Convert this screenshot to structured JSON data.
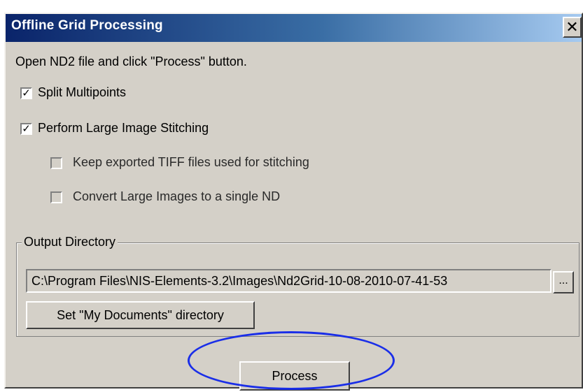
{
  "window": {
    "title": "Offline Grid Processing",
    "close_label": "✕"
  },
  "instructions": "Open ND2 file and click \"Process\" button.",
  "options": [
    {
      "label": "Split Multipoints",
      "checked": true,
      "enabled": true
    },
    {
      "label": "Perform Large Image Stitching",
      "checked": true,
      "enabled": true
    },
    {
      "label": "Keep exported TIFF files used for stitching",
      "checked": false,
      "enabled": false
    },
    {
      "label": "Convert Large Images to a single ND",
      "checked": false,
      "enabled": false
    }
  ],
  "output": {
    "group_label": "Output Directory",
    "path_value": "C:\\Program Files\\NIS-Elements-3.2\\Images\\Nd2Grid-10-08-2010-07-41-53",
    "browse_label": "...",
    "my_documents_label": "Set \"My Documents\" directory"
  },
  "actions": {
    "process_label": "Process"
  },
  "colors": {
    "dialog_bg": "#d4d0c8",
    "titlebar_start": "#0a246a",
    "highlight": "#1a2ee8"
  },
  "icons": {
    "close": "close-icon",
    "checkmark": "checkmark-icon"
  }
}
